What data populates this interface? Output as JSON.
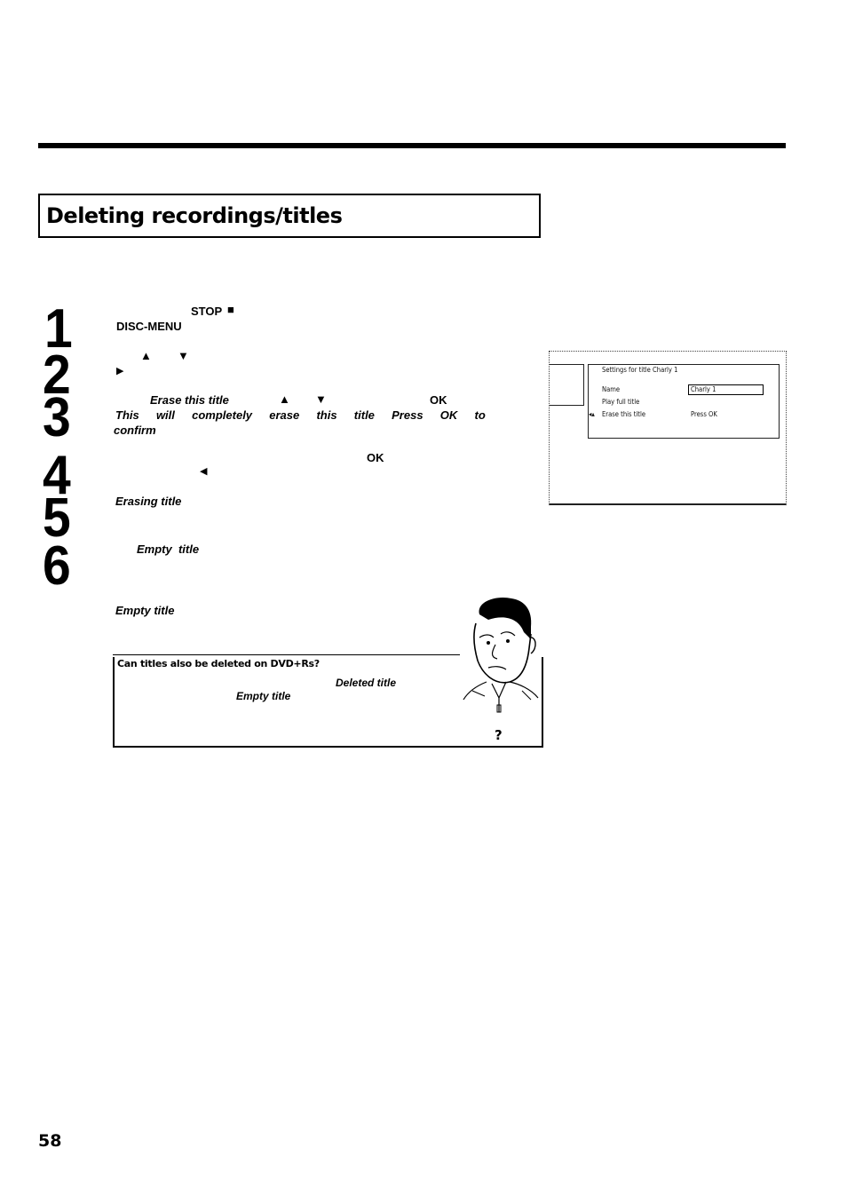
{
  "page": {
    "title": "Deleting recordings/titles",
    "page_number": "58"
  },
  "steps": [
    {
      "number": "1",
      "keys": [
        "STOP",
        "DISC-MENU"
      ],
      "icons": [
        "stop-square-icon"
      ]
    },
    {
      "number": "2",
      "icons": [
        "up-arrow-icon",
        "down-arrow-icon",
        "right-arrow-icon"
      ]
    },
    {
      "number": "3",
      "menu_item": "Erase this title",
      "key": "OK",
      "message": "This  will  completely  erase  this  title  Press  OK  to",
      "message_end": "confirm",
      "icons": [
        "up-arrow-icon",
        "down-arrow-icon"
      ]
    },
    {
      "number": "4",
      "key": "OK",
      "icons": [
        "left-arrow-icon"
      ]
    },
    {
      "number": "5",
      "status": "Erasing title"
    },
    {
      "number": "6",
      "status": "Empty  title"
    }
  ],
  "glyphs": {
    "stop": "■",
    "up": "▲",
    "down": "▼",
    "right": "▶",
    "left": "◀"
  },
  "note_after_steps": "Empty title",
  "screen": {
    "heading": "Settings for title Charly 1",
    "rows": [
      {
        "label": "Name",
        "value": "Charly 1"
      },
      {
        "label": "Play full title",
        "value": ""
      },
      {
        "label": "Erase this title",
        "value": "Press OK"
      }
    ],
    "selected_row": 2
  },
  "faq": {
    "question": "Can titles also be deleted on DVD+Rs?",
    "term1": "Deleted title",
    "term2": "Empty title",
    "question_mark": "?"
  }
}
